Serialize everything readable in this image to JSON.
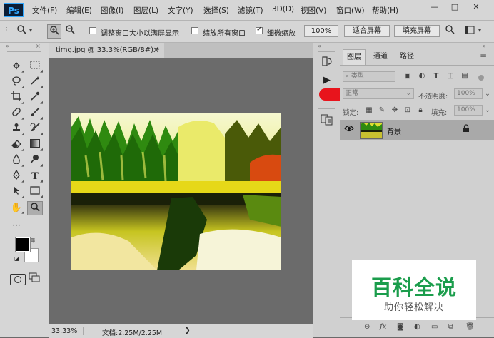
{
  "app": {
    "logo": "Ps"
  },
  "menu": [
    "文件(F)",
    "编辑(E)",
    "图像(I)",
    "图层(L)",
    "文字(Y)",
    "选择(S)",
    "滤镜(T)",
    "3D(D)",
    "视图(V)",
    "窗口(W)",
    "帮助(H)"
  ],
  "window_controls": {
    "minimize": "—",
    "restore": "□",
    "close": "✕"
  },
  "options": {
    "resize_windows_label": "调整窗口大小以满屏显示",
    "zoom_all_label": "缩放所有窗口",
    "scrubby_zoom_label": "细微缩放",
    "zoom_value": "100%",
    "fit_screen_label": "适合屏幕",
    "fill_screen_label": "填充屏幕",
    "resize_windows_checked": false,
    "zoom_all_checked": false,
    "scrubby_zoom_checked": true
  },
  "document": {
    "tab_title": "timg.jpg @ 33.3%(RGB/8#) *",
    "zoom": "33.33%",
    "doc_info": "文档:2.25M/2.25M"
  },
  "layers_panel": {
    "tabs": [
      "图层",
      "通道",
      "路径"
    ],
    "active_tab": "图层",
    "kind_placeholder": "类型",
    "blend_mode": "正常",
    "opacity_label": "不透明度:",
    "opacity_value": "100%",
    "lock_label": "锁定:",
    "fill_label": "填充:",
    "fill_value": "100%",
    "layers": [
      {
        "name": "背景",
        "visible": true,
        "locked": true
      }
    ]
  },
  "watermark": {
    "title": "百科全说",
    "subtitle": "助你轻松解决"
  },
  "colors": {
    "foreground": "#000000",
    "background": "#ffffff",
    "watermark_green": "#1b9d4c"
  }
}
